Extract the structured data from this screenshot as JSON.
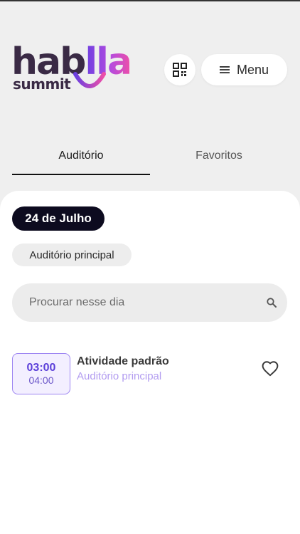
{
  "header": {
    "logo": {
      "word_start": "hab",
      "word_end": "lla",
      "sub": "summit"
    },
    "qr_icon": "qr-code-icon",
    "menu": {
      "icon": "hamburger-icon",
      "label": "Menu"
    }
  },
  "tabs": [
    {
      "label": "Auditório",
      "active": true
    },
    {
      "label": "Favoritos",
      "active": false
    }
  ],
  "filters": {
    "date": "24 de Julho",
    "room": "Auditório principal"
  },
  "search": {
    "placeholder": "Procurar nesse dia",
    "value": "",
    "icon": "search-icon"
  },
  "sessions": [
    {
      "start": "03:00",
      "end": "04:00",
      "title": "Atividade padrão",
      "room": "Auditório principal",
      "favorite_icon": "heart-outline-icon"
    }
  ],
  "colors": {
    "accent": "#5b3fd9",
    "accent_light": "#b29cf0",
    "date_pill": "#0d0b1f",
    "background": "#efefef"
  }
}
